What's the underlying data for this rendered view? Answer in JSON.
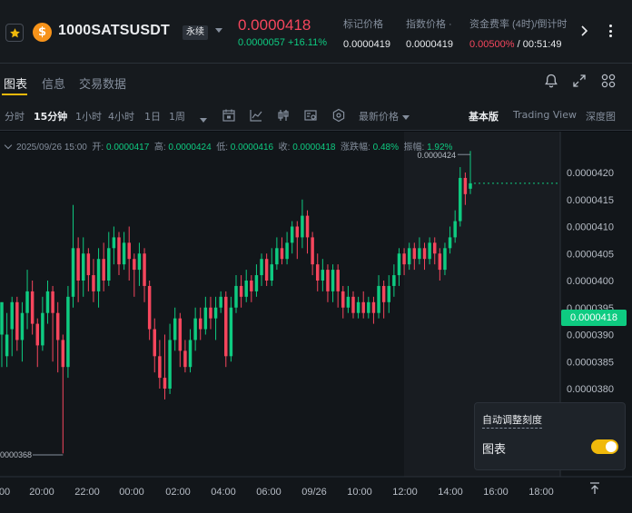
{
  "header": {
    "symbol": "1000SATSUSDT",
    "contract_type": "永续",
    "last_price": "0.0000418",
    "change": "0.0000057 +16.11%",
    "coin_glyph": "$",
    "stats": [
      {
        "label": "标记价格",
        "value": "0.0000419"
      },
      {
        "label": "指数价格 ·",
        "value": "0.0000419"
      },
      {
        "label": "资金费率 (4时)/倒计时",
        "value_rate": "0.00500%",
        "value_sep": " / ",
        "value_time": "00:51:49"
      }
    ],
    "icons": [
      "star-icon",
      "chevron-right-icon",
      "more-vertical-icon"
    ]
  },
  "tabs": [
    {
      "label": "图表",
      "active": true
    },
    {
      "label": "信息",
      "active": false
    },
    {
      "label": "交易数据",
      "active": false
    }
  ],
  "tab_icons": [
    "bell-icon",
    "expand-icon",
    "grid-layout-icon"
  ],
  "toolbar": {
    "timeframes": [
      {
        "label": "分时",
        "active": false
      },
      {
        "label": "15分钟",
        "active": true
      },
      {
        "label": "1小时",
        "active": false
      },
      {
        "label": "4小时",
        "active": false
      },
      {
        "label": "1日",
        "active": false
      },
      {
        "label": "1周",
        "active": false
      }
    ],
    "latest_price_label": "最新价格",
    "views": [
      {
        "label": "基本版",
        "active": true
      },
      {
        "label": "Trading View",
        "active": false
      },
      {
        "label": "深度图",
        "active": false
      }
    ]
  },
  "ohlc": {
    "date": "2025/09/26 15:00",
    "open_label": "开:",
    "open": "0.0000417",
    "high_label": "高:",
    "high": "0.0000424",
    "low_label": "低:",
    "low": "0.0000416",
    "close_label": "收:",
    "close": "0.0000418",
    "change_label": "涨跌幅:",
    "change": "0.48%",
    "amp_label": "振幅:",
    "amp": "1.92%"
  },
  "current_price_tag": "0.0000418",
  "auto_scale": {
    "title": "自动调整刻度",
    "label": "图表",
    "enabled": true
  },
  "colors": {
    "up": "#0ecb81",
    "down": "#f6465d",
    "accent": "#f0b90b"
  },
  "chart_data": {
    "type": "candlestick",
    "interval": "15m",
    "y_ticks": [
      "0.0000420",
      "0.0000415",
      "0.0000410",
      "0.0000405",
      "0.0000400",
      "0.0000395",
      "0.0000390",
      "0.0000385",
      "0.0000380"
    ],
    "y_tick_values": [
      4.2e-05,
      4.15e-05,
      4.1e-05,
      4.05e-05,
      4e-05,
      3.95e-05,
      3.9e-05,
      3.85e-05,
      3.8e-05
    ],
    "x_ticks": [
      "00",
      "20:00",
      "22:00",
      "00:00",
      "02:00",
      "04:00",
      "06:00",
      "09/26",
      "10:00",
      "12:00",
      "14:00",
      "16:00",
      "18:00"
    ],
    "high_annotation": "0.0000424",
    "low_annotation": "0000368",
    "candles": [
      [
        3.9e-05,
        3.96e-05,
        3.94e-05,
        3.84e-05
      ],
      [
        3.86e-05,
        3.9e-05,
        3.94e-05,
        3.84e-05
      ],
      [
        3.91e-05,
        3.96e-05,
        3.97e-05,
        3.86e-05
      ],
      [
        3.96e-05,
        3.89e-05,
        3.97e-05,
        3.87e-05
      ],
      [
        3.89e-05,
        3.94e-05,
        3.96e-05,
        3.85e-05
      ],
      [
        3.94e-05,
        3.98e-05,
        4.02e-05,
        3.91e-05
      ],
      [
        3.98e-05,
        3.92e-05,
        4e-05,
        3.9e-05
      ],
      [
        3.92e-05,
        3.88e-05,
        3.93e-05,
        3.84e-05
      ],
      [
        3.88e-05,
        3.94e-05,
        3.97e-05,
        3.87e-05
      ],
      [
        3.94e-05,
        3.98e-05,
        4e-05,
        3.92e-05
      ],
      [
        3.98e-05,
        3.94e-05,
        3.99e-05,
        3.85e-05
      ],
      [
        3.94e-05,
        3.89e-05,
        3.96e-05,
        3.83e-05
      ],
      [
        3.89e-05,
        3.84e-05,
        3.9e-05,
        3.68e-05
      ],
      [
        3.84e-05,
        3.97e-05,
        3.99e-05,
        3.82e-05
      ],
      [
        3.97e-05,
        4.06e-05,
        4.14e-05,
        3.95e-05
      ],
      [
        4.06e-05,
        4e-05,
        4.08e-05,
        3.96e-05
      ],
      [
        4e-05,
        4.05e-05,
        4.08e-05,
        3.97e-05
      ],
      [
        4.05e-05,
        4.01e-05,
        4.06e-05,
        3.98e-05
      ],
      [
        4.01e-05,
        3.98e-05,
        4.04e-05,
        3.96e-05
      ],
      [
        3.98e-05,
        4.04e-05,
        4.06e-05,
        3.95e-05
      ],
      [
        4.04e-05,
        4e-05,
        4.07e-05,
        3.98e-05
      ],
      [
        4e-05,
        4.06e-05,
        4.09e-05,
        3.99e-05
      ],
      [
        4.06e-05,
        4.08e-05,
        4.1e-05,
        4.03e-05
      ],
      [
        4.08e-05,
        4.03e-05,
        4.09e-05,
        4.01e-05
      ],
      [
        4.03e-05,
        4.07e-05,
        4.09e-05,
        4.02e-05
      ],
      [
        4.07e-05,
        4.04e-05,
        4.1e-05,
        4e-05
      ],
      [
        4.04e-05,
        4.02e-05,
        4.05e-05,
        3.97e-05
      ],
      [
        4.02e-05,
        4.05e-05,
        4.07e-05,
        3.99e-05
      ],
      [
        4.05e-05,
        3.99e-05,
        4.06e-05,
        3.96e-05
      ],
      [
        3.99e-05,
        3.91e-05,
        4e-05,
        3.89e-05
      ],
      [
        3.91e-05,
        3.86e-05,
        3.93e-05,
        3.83e-05
      ],
      [
        3.86e-05,
        3.82e-05,
        3.89e-05,
        3.8e-05
      ],
      [
        3.82e-05,
        3.8e-05,
        3.9e-05,
        3.78e-05
      ],
      [
        3.8e-05,
        3.89e-05,
        3.92e-05,
        3.79e-05
      ],
      [
        3.89e-05,
        3.93e-05,
        3.95e-05,
        3.87e-05
      ],
      [
        3.93e-05,
        3.87e-05,
        3.94e-05,
        3.84e-05
      ],
      [
        3.87e-05,
        3.84e-05,
        3.89e-05,
        3.83e-05
      ],
      [
        3.84e-05,
        3.89e-05,
        3.91e-05,
        3.83e-05
      ],
      [
        3.89e-05,
        3.93e-05,
        3.95e-05,
        3.87e-05
      ],
      [
        3.93e-05,
        3.91e-05,
        3.95e-05,
        3.89e-05
      ],
      [
        3.91e-05,
        3.95e-05,
        3.97e-05,
        3.9e-05
      ],
      [
        3.95e-05,
        3.93e-05,
        3.97e-05,
        3.91e-05
      ],
      [
        3.93e-05,
        3.95e-05,
        3.97e-05,
        3.89e-05
      ],
      [
        3.95e-05,
        3.97e-05,
        3.98e-05,
        3.94e-05
      ],
      [
        3.97e-05,
        3.86e-05,
        3.98e-05,
        3.84e-05
      ],
      [
        3.86e-05,
        3.95e-05,
        3.97e-05,
        3.85e-05
      ],
      [
        3.95e-05,
        3.99e-05,
        4.01e-05,
        3.94e-05
      ],
      [
        3.99e-05,
        3.97e-05,
        4.01e-05,
        3.95e-05
      ],
      [
        3.97e-05,
        4e-05,
        4.02e-05,
        3.96e-05
      ],
      [
        4e-05,
        3.98e-05,
        4.01e-05,
        3.96e-05
      ],
      [
        3.98e-05,
        4.01e-05,
        4.03e-05,
        3.97e-05
      ],
      [
        4.01e-05,
        4.04e-05,
        4.05e-05,
        3.99e-05
      ],
      [
        4.04e-05,
        4e-05,
        4.05e-05,
        3.99e-05
      ],
      [
        4e-05,
        4.03e-05,
        4.06e-05,
        3.99e-05
      ],
      [
        4.03e-05,
        4.06e-05,
        4.08e-05,
        4.02e-05
      ],
      [
        4.06e-05,
        4.04e-05,
        4.08e-05,
        4.03e-05
      ],
      [
        4.04e-05,
        4.07e-05,
        4.09e-05,
        4.03e-05
      ],
      [
        4.07e-05,
        4.1e-05,
        4.11e-05,
        4.05e-05
      ],
      [
        4.1e-05,
        4.08e-05,
        4.11e-05,
        4.04e-05
      ],
      [
        4.08e-05,
        4.12e-05,
        4.15e-05,
        4.06e-05
      ],
      [
        4.12e-05,
        4.08e-05,
        4.13e-05,
        4.05e-05
      ],
      [
        4.08e-05,
        4.03e-05,
        4.09e-05,
        4.01e-05
      ],
      [
        4.03e-05,
        4e-05,
        4.05e-05,
        3.98e-05
      ],
      [
        4e-05,
        4.02e-05,
        4.04e-05,
        3.98e-05
      ],
      [
        4.02e-05,
        3.98e-05,
        4.03e-05,
        3.96e-05
      ],
      [
        3.98e-05,
        4.02e-05,
        4.03e-05,
        3.96e-05
      ],
      [
        4.02e-05,
        3.98e-05,
        4.03e-05,
        3.95e-05
      ],
      [
        3.98e-05,
        3.95e-05,
        3.99e-05,
        3.93e-05
      ],
      [
        3.95e-05,
        3.97e-05,
        3.99e-05,
        3.94e-05
      ],
      [
        3.97e-05,
        3.94e-05,
        3.98e-05,
        3.93e-05
      ],
      [
        3.94e-05,
        3.96e-05,
        3.97e-05,
        3.93e-05
      ],
      [
        3.96e-05,
        3.94e-05,
        3.98e-05,
        3.93e-05
      ],
      [
        3.94e-05,
        3.96e-05,
        3.97e-05,
        3.93e-05
      ],
      [
        3.96e-05,
        3.94e-05,
        3.97e-05,
        3.92e-05
      ],
      [
        3.94e-05,
        3.99e-05,
        4.01e-05,
        3.93e-05
      ],
      [
        3.99e-05,
        3.96e-05,
        4e-05,
        3.93e-05
      ],
      [
        3.96e-05,
        3.99e-05,
        4.01e-05,
        3.94e-05
      ],
      [
        3.99e-05,
        4.01e-05,
        4.03e-05,
        3.97e-05
      ],
      [
        4.01e-05,
        4.05e-05,
        4.06e-05,
        3.99e-05
      ],
      [
        4.05e-05,
        4.03e-05,
        4.06e-05,
        4.01e-05
      ],
      [
        4.03e-05,
        4.06e-05,
        4.07e-05,
        4.02e-05
      ],
      [
        4.06e-05,
        4.04e-05,
        4.07e-05,
        4.02e-05
      ],
      [
        4.04e-05,
        4.06e-05,
        4.08e-05,
        4.03e-05
      ],
      [
        4.06e-05,
        4.04e-05,
        4.07e-05,
        4.02e-05
      ],
      [
        4.04e-05,
        4.07e-05,
        4.08e-05,
        4.03e-05
      ],
      [
        4.07e-05,
        4.05e-05,
        4.08e-05,
        4.03e-05
      ],
      [
        4.05e-05,
        4.02e-05,
        4.06e-05,
        4e-05
      ],
      [
        4.02e-05,
        4.06e-05,
        4.07e-05,
        4.01e-05
      ],
      [
        4.06e-05,
        4.08e-05,
        4.1e-05,
        4.05e-05
      ],
      [
        4.08e-05,
        4.11e-05,
        4.13e-05,
        4.07e-05
      ],
      [
        4.11e-05,
        4.19e-05,
        4.21e-05,
        4.1e-05
      ],
      [
        4.19e-05,
        4.16e-05,
        4.2e-05,
        4.14e-05
      ],
      [
        4.17e-05,
        4.18e-05,
        4.24e-05,
        4.16e-05
      ]
    ]
  }
}
